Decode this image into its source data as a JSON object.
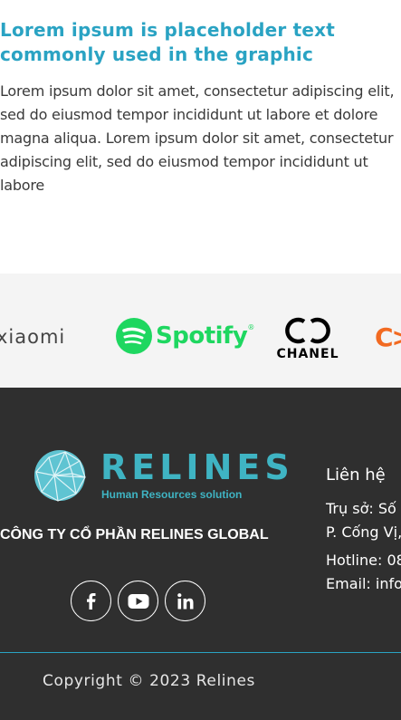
{
  "intro": {
    "title": "Lorem ipsum is placeholder text commonly used in the graphic",
    "body": "Lorem ipsum dolor sit amet, consectetur adipiscing elit, sed do eiusmod tempor incididunt ut labore et dolore magna aliqua. Lorem ipsum dolor sit amet, consectetur adipiscing elit, sed do eiusmod tempor incididunt ut labore"
  },
  "brands": {
    "xiaomi": "xiaomi",
    "spotify": "Spotify",
    "spotify_mark": "®",
    "chanel": "CHANEL",
    "partial": "C>"
  },
  "footer": {
    "logo_word": "RELINES",
    "logo_tagline": "Human Resources solution",
    "company_name": "CÔNG TY CỔ PHẦN RELINES GLOBAL",
    "socials": [
      {
        "icon": "facebook-icon"
      },
      {
        "icon": "youtube-icon"
      },
      {
        "icon": "linkedin-icon"
      }
    ],
    "contact": {
      "title": "Liên hệ",
      "address_line1": "Trụ sở: Số",
      "address_line2": "P. Cống Vị,",
      "hotline": "Hotline: 08",
      "email": "Email: info"
    },
    "copyright": "Copyright © 2023 Relines"
  },
  "colors": {
    "accent": "#2aa3c3",
    "footer_bg": "#2f2f2f",
    "spotify_green": "#1ed760"
  }
}
